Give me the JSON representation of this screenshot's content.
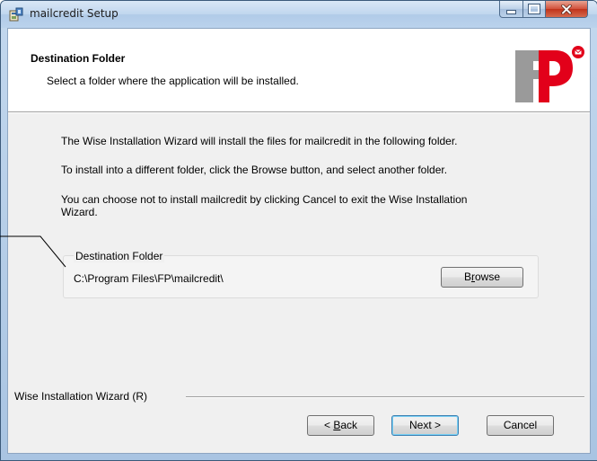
{
  "window": {
    "title": "mailcredit Setup",
    "controls": {
      "minimize": "minimize",
      "maximize": "maximize",
      "close": "close"
    }
  },
  "header": {
    "title": "Destination Folder",
    "subtitle": "Select a folder where the application will be installed.",
    "logo_icon": "fp-logo"
  },
  "body": {
    "paragraph1": "The Wise Installation Wizard will install the files for mailcredit in the following folder.",
    "paragraph2": "To install into a different folder, click the Browse button, and select another folder.",
    "paragraph3_line1": "You can choose not to install mailcredit by clicking Cancel to exit the Wise Installation",
    "paragraph3_line2": "Wizard."
  },
  "destination": {
    "group_label": "Destination Folder",
    "path": "C:\\Program Files\\FP\\mailcredit\\",
    "browse_label_pre": "B",
    "browse_label_accel": "r",
    "browse_label_post": "owse"
  },
  "footer": {
    "wizard_label": "Wise Installation Wizard (R)",
    "back_prefix": "< ",
    "back_accel": "B",
    "back_rest": "ack",
    "next_label": "Next >",
    "cancel_label": "Cancel"
  },
  "colors": {
    "titlebar": "#bad2ec",
    "dialog_bg": "#f0f0f0",
    "close_button": "#c0331b",
    "logo_red": "#e2001a",
    "logo_gray": "#9a9a9a"
  }
}
